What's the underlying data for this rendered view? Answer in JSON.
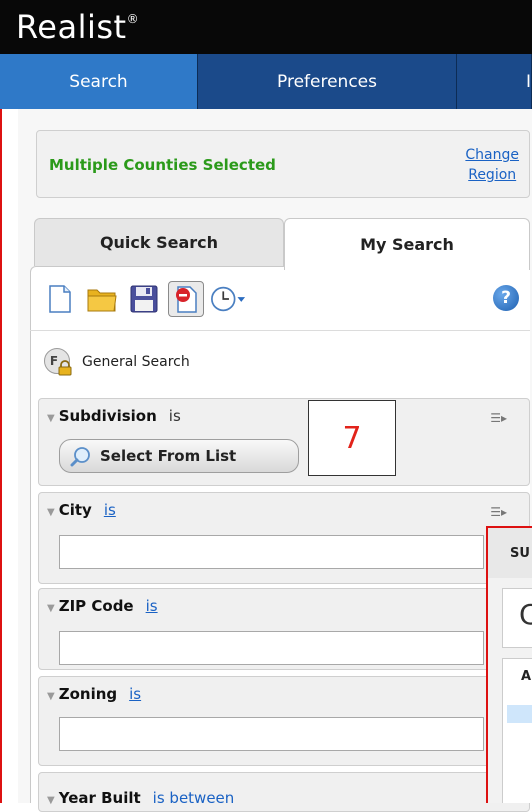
{
  "app": {
    "brand": "Realist",
    "brand_mark": "®"
  },
  "nav": {
    "tabs": [
      {
        "label": "Search",
        "active": true
      },
      {
        "label": "Preferences",
        "active": false
      },
      {
        "label": "I",
        "active": false
      }
    ]
  },
  "region": {
    "title": "Multiple Counties Selected",
    "change_line1": "Change",
    "change_line2": "Region"
  },
  "search_tabs": {
    "quick": "Quick Search",
    "mine": "My Search"
  },
  "toolbar": {
    "icons": [
      "new-document-icon",
      "open-folder-icon",
      "save-icon",
      "remove-icon",
      "history-clock-icon",
      "help-icon"
    ],
    "help_glyph": "?"
  },
  "general_search": {
    "badge": "F",
    "label": "General Search"
  },
  "criteria": {
    "subdivision": {
      "name": "Subdivision",
      "op": "is",
      "button": "Select From List"
    },
    "city": {
      "name": "City",
      "op": "is",
      "value": ""
    },
    "zip": {
      "name": "ZIP Code",
      "op": "is",
      "value": ""
    },
    "zoning": {
      "name": "Zoning",
      "op": "is",
      "value": ""
    },
    "year_built": {
      "name": "Year Built",
      "op": "is between"
    }
  },
  "annotation": {
    "number": "7"
  },
  "popup": {
    "title": "SU",
    "big_letter": "C",
    "list_header": "A"
  },
  "colors": {
    "brand_bar": "#080808",
    "nav": "#1b4a8a",
    "nav_active": "#2f79c8",
    "region_text": "#2b9a1a",
    "link": "#1a62c4",
    "annotation": "#e2231a",
    "frame": "#dd1111"
  }
}
